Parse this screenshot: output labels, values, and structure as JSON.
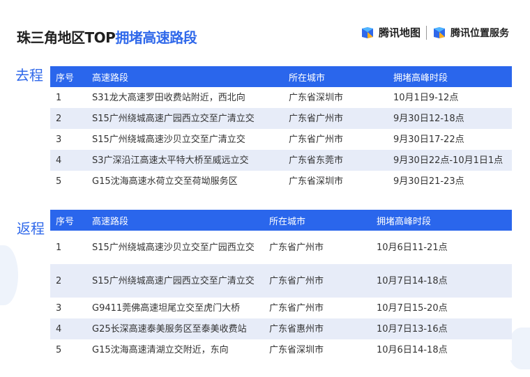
{
  "title": {
    "prefix": "珠三角地区TOP",
    "highlight": "拥堵高速路段"
  },
  "brand": {
    "map": "腾讯地图",
    "service": "腾讯位置服务"
  },
  "outbound": {
    "label": "去程",
    "headers": [
      "序号",
      "高速路段",
      "所在城市",
      "拥堵高峰时段"
    ],
    "rows": [
      [
        "1",
        "S31龙大高速罗田收费站附近，西北向",
        "广东省深圳市",
        "10月1日9-12点"
      ],
      [
        "2",
        "S15广州绕城高速广园西立交至广清立交",
        "广东省广州市",
        "9月30日12-18点"
      ],
      [
        "3",
        "S15广州绕城高速沙贝立交至广清立交",
        "广东省广州市",
        "9月30日17-22点"
      ],
      [
        "4",
        "S3广深沿江高速太平特大桥至威远立交",
        "广东省东莞市",
        "9月30日22点-10月1日1点"
      ],
      [
        "5",
        "G15沈海高速水荷立交至荷坳服务区",
        "广东省深圳市",
        "9月30日21-23点"
      ]
    ]
  },
  "return": {
    "label": "返程",
    "headers": [
      "序号",
      "高速路段",
      "所在城市",
      "拥堵高峰时段"
    ],
    "rows": [
      [
        "1",
        "S15广州绕城高速沙贝立交至广园西立交",
        "广东省广州市",
        "10月6日11-21点"
      ],
      [
        "2",
        "S15广州绕城高速广园西立交至广清立交",
        "广东省广州市",
        "10月7日14-18点"
      ],
      [
        "3",
        "G9411莞佛高速坦尾立交至虎门大桥",
        "广东省广州市",
        "10月7日15-20点"
      ],
      [
        "4",
        "G25长深高速泰美服务区至泰美收费站",
        "广东省惠州市",
        "10月7日13-16点"
      ],
      [
        "5",
        "G15沈海高速清湖立交附近，东向",
        "广东省深圳市",
        "10月6日14-18点"
      ]
    ]
  },
  "colors": {
    "accent": "#2a66ec",
    "stripe": "#e7ecf8",
    "title_highlight": "#2f68ea"
  },
  "icons": [
    "tencent-map-logo-icon",
    "tencent-location-logo-icon"
  ]
}
